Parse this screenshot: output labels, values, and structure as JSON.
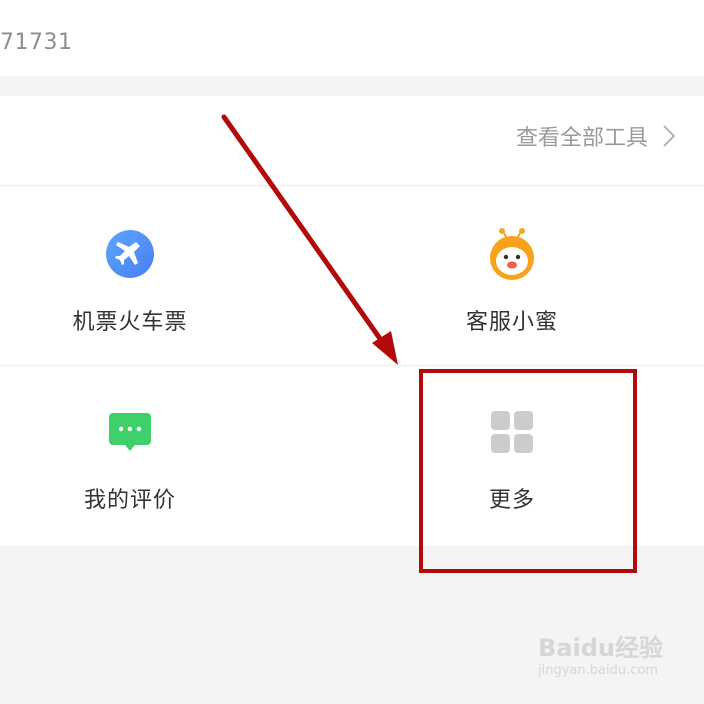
{
  "top_bar": {
    "number_text": "71731"
  },
  "tools_section": {
    "view_all_label": "查看全部工具"
  },
  "tools": [
    {
      "label": "机票火车票",
      "icon": "plane-icon",
      "color": "#4f8ef7"
    },
    {
      "label": "客服小蜜",
      "icon": "bee-mascot-icon",
      "color": "#f6a623"
    },
    {
      "label": "我的评价",
      "icon": "chat-bubble-icon",
      "color": "#3ecf6a"
    },
    {
      "label": "更多",
      "icon": "grid-icon",
      "color": "#cccccc"
    }
  ],
  "annotation": {
    "highlight_color": "#b20a0a"
  },
  "watermark": {
    "brand": "Baidu经验",
    "url": "jingyan.baidu.com"
  }
}
